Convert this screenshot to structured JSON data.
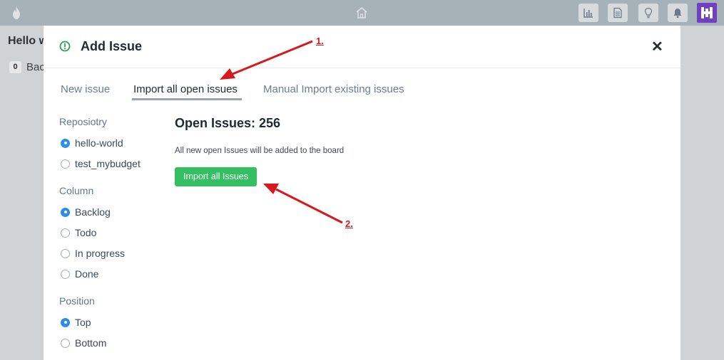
{
  "topbar": {
    "icons": [
      "flame-icon",
      "home-icon",
      "chart-icon",
      "document-icon",
      "lightbulb-icon",
      "bell-icon",
      "app-logo"
    ]
  },
  "background": {
    "title": "Hello w",
    "badge": "0",
    "column": "Bac"
  },
  "modal": {
    "title": "Add Issue",
    "close": "✕",
    "tabs": [
      {
        "label": "New issue"
      },
      {
        "label": "Import all open issues"
      },
      {
        "label": "Manual Import existing issues"
      }
    ],
    "active_tab": "Import all open issues",
    "repository": {
      "label": "Reposiotry",
      "options": [
        "hello-world",
        "test_mybudget"
      ],
      "selected": "hello-world"
    },
    "column": {
      "label": "Column",
      "options": [
        "Backlog",
        "Todo",
        "In progress",
        "Done"
      ],
      "selected": "Backlog"
    },
    "position": {
      "label": "Position",
      "options": [
        "Top",
        "Bottom"
      ],
      "selected": "Top"
    },
    "open_issues_title": "Open Issues: 256",
    "description": "All new open Issues will be added to the board",
    "import_button": "Import all Issues"
  },
  "annotations": {
    "step1": "1.",
    "step2": "2.",
    "color": "#d7191f"
  },
  "colors": {
    "accent_green": "#34bf63",
    "radio_blue": "#2c8fe6",
    "logo_purple": "#6f3fc4"
  }
}
